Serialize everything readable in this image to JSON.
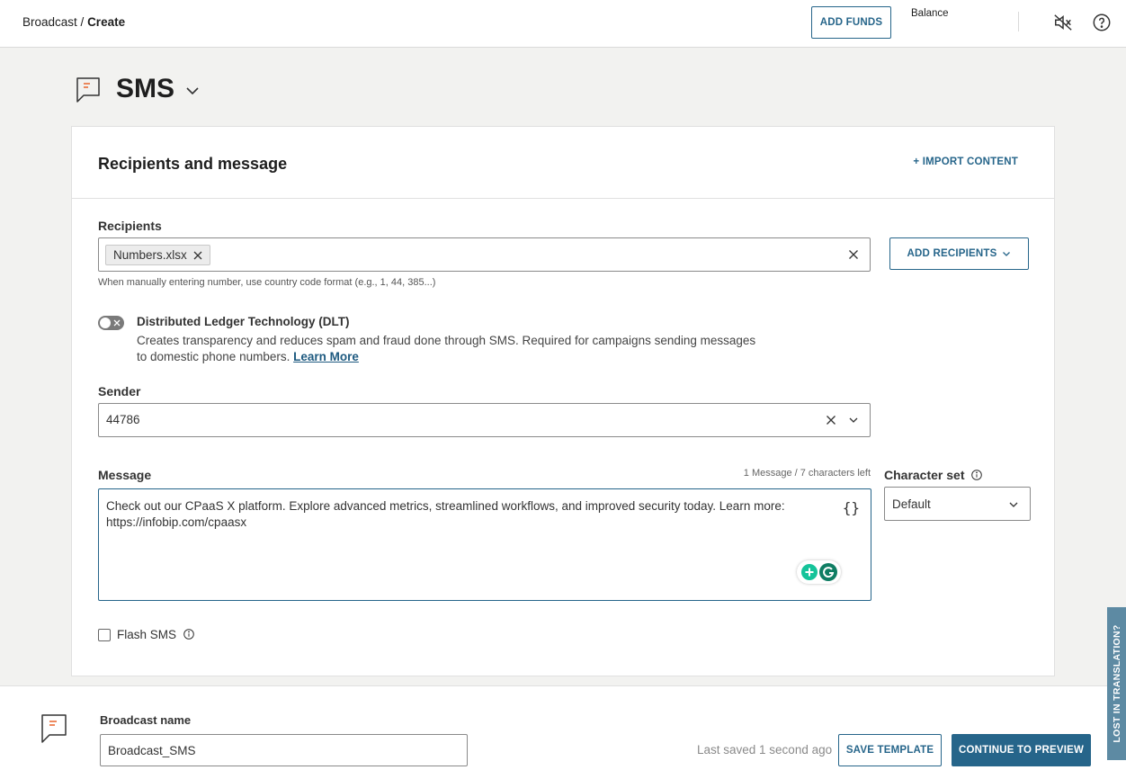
{
  "header": {
    "breadcrumb_root": "Broadcast",
    "breadcrumb_sep": " / ",
    "breadcrumb_current": "Create",
    "add_funds_label": "ADD FUNDS",
    "balance_label": "Balance",
    "icons": [
      "speaker-muted-icon",
      "help-icon"
    ]
  },
  "page": {
    "channel_title": "SMS",
    "channel_icon": "message-flag-icon"
  },
  "card": {
    "title": "Recipients and message",
    "import_label": "+ IMPORT CONTENT"
  },
  "recipients": {
    "label": "Recipients",
    "chip": "Numbers.xlsx",
    "hint": "When manually entering number, use country code format (e.g., 1, 44, 385...)",
    "add_label": "ADD RECIPIENTS"
  },
  "dlt": {
    "enabled": false,
    "title": "Distributed Ledger Technology (DLT)",
    "description": "Creates transparency and reduces spam and fraud done through SMS. Required for campaigns sending messages to domestic phone numbers.",
    "link": "Learn More"
  },
  "sender": {
    "label": "Sender",
    "value": "44786"
  },
  "message": {
    "label": "Message",
    "counter": "1 Message / 7 characters left",
    "text": "Check out our CPaaS X platform. Explore advanced metrics, streamlined workflows, and improved security today. Learn more: https://infobip.com/cpaasx",
    "placeholder_button": "{}"
  },
  "charset": {
    "label": "Character set",
    "value": "Default"
  },
  "flash": {
    "label": "Flash SMS",
    "checked": false
  },
  "footer": {
    "name_label": "Broadcast name",
    "name_value": "Broadcast_SMS",
    "saved_text": "Last saved 1 second ago",
    "save_template_label": "SAVE TEMPLATE",
    "continue_label": "CONTINUE TO PREVIEW"
  },
  "side_tab": {
    "label": "LOST IN TRANSLATION?"
  },
  "colors": {
    "accent": "#26658a",
    "background": "#f2f2f0",
    "side_tab": "#5d8aa3"
  }
}
